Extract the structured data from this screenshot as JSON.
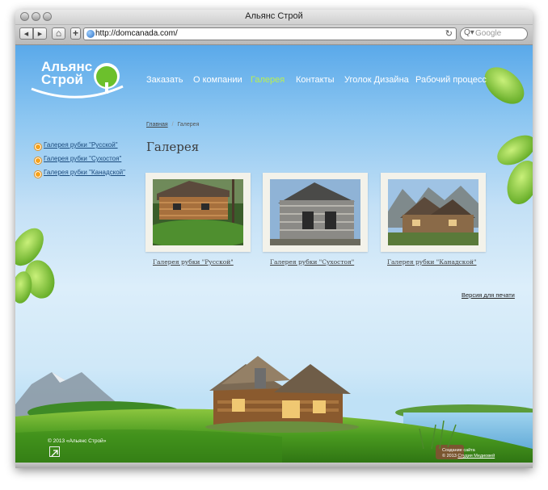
{
  "browser": {
    "window_title": "Альянс Строй",
    "url": "http://domcanada.com/",
    "search_placeholder": "Google",
    "back_glyph": "◀",
    "forward_glyph": "▶",
    "home_glyph": "⌂",
    "add_glyph": "+",
    "reload_glyph": "↻",
    "search_glyph": "Q▾"
  },
  "site": {
    "logo_line1": "Альянс",
    "logo_line2": "Строй",
    "nav": [
      {
        "label": "Заказать",
        "active": false
      },
      {
        "label": "О компании",
        "active": false
      },
      {
        "label": "Галерея",
        "active": true
      },
      {
        "label": "Контакты",
        "active": false
      },
      {
        "label": "Уголок Дизайна",
        "active": false
      },
      {
        "label": "Рабочий процесс",
        "active": false
      }
    ],
    "breadcrumb": {
      "home": "Главная",
      "separator": "/",
      "current": "Галерея"
    },
    "page_title": "Галерея",
    "sidebar": [
      "Галерея рубки \"Русской\"",
      "Галерея рубки \"Сухостоя\"",
      "Галерея рубки \"Канадской\""
    ],
    "gallery": [
      {
        "caption": "Галерея рубки \"Русской\""
      },
      {
        "caption": "Галерея рубки \"Сухостоя\""
      },
      {
        "caption": "Галерея рубки \"Канадской\""
      }
    ],
    "print_version": "Версия для печати",
    "copyright": "© 2013 «Альянс Строй»",
    "studio_line1": "Создание сайта",
    "studio_line2_prefix": "© 2013",
    "studio_link": "Студия Медиовей"
  },
  "colors": {
    "nav_active": "#b9f051",
    "link": "#1b4b7d",
    "bullet": "#f7a21a",
    "sky_top": "#5aa9ea",
    "grass": "#3f8f1c"
  }
}
